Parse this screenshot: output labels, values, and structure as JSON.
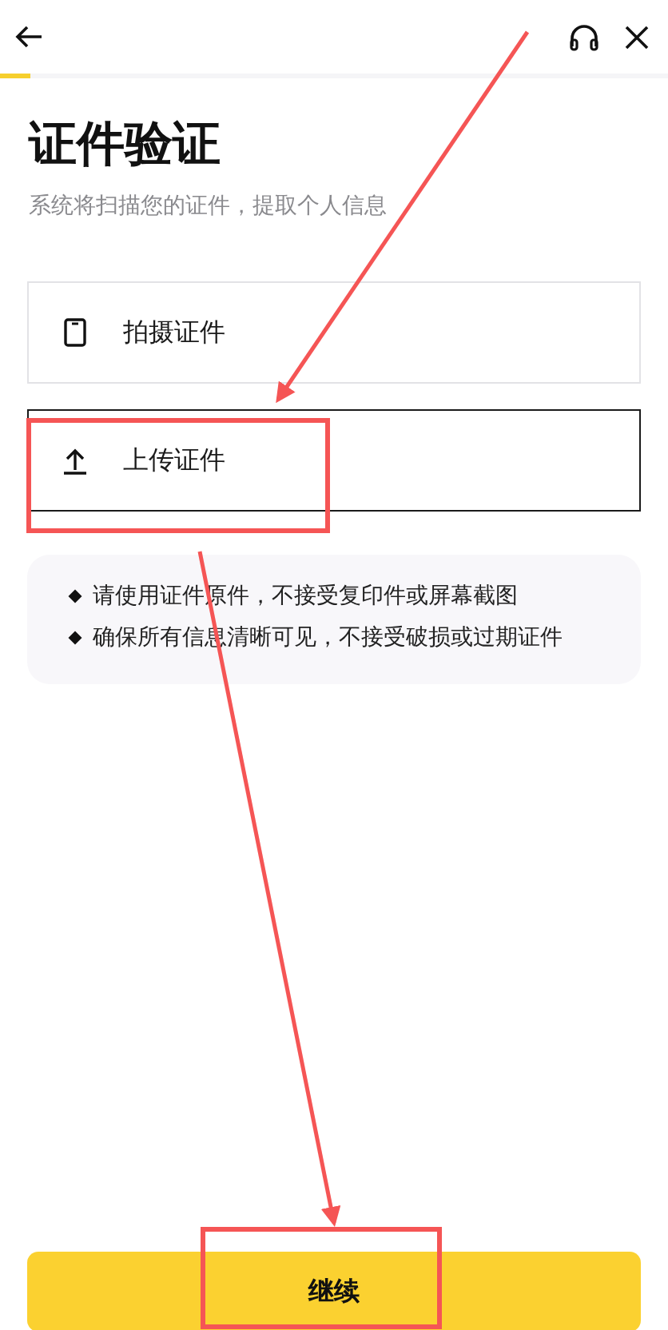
{
  "progress": {
    "level": 0.045
  },
  "title": "证件验证",
  "subtitle": "系统将扫描您的证件，提取个人信息",
  "options": [
    {
      "kind": "phone",
      "label": "拍摄证件",
      "selected": false
    },
    {
      "kind": "upload",
      "label": "上传证件",
      "selected": true
    }
  ],
  "tips": [
    "请使用证件原件，不接受复印件或屏幕截图",
    "确保所有信息清晰可见，不接受破损或过期证件"
  ],
  "button": "继续"
}
